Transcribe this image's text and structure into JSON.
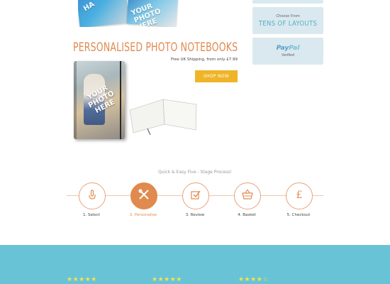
{
  "top_images": {
    "book_watermark_left": "HA",
    "book_watermark_right": "YOUR PHOTO HERE"
  },
  "info_boxes": {
    "choose_caption": "Choose From",
    "choose_main": "TENS OF LAYOUTS",
    "paypal_logo_1": "Pay",
    "paypal_logo_2": "Pal",
    "paypal_caption": "Verified"
  },
  "product": {
    "title": "PERSONALISED PHOTO NOTEBOOKS",
    "shipping": "Free UK Shipping, from only £7.99",
    "shop_button": "SHOP NOW",
    "notebook_watermark": "YOUR PHOTO HERE"
  },
  "process": {
    "title": "Quick & Easy Five - Stage Process!",
    "steps": [
      {
        "label": "1. Select",
        "icon": "hand-pointer-icon",
        "active": false
      },
      {
        "label": "2. Personalise",
        "icon": "tools-icon",
        "active": true
      },
      {
        "label": "3. Review",
        "icon": "checkbox-icon",
        "active": false
      },
      {
        "label": "4. Basket",
        "icon": "basket-icon",
        "active": false
      },
      {
        "label": "5. Checkout",
        "icon": "pound-icon",
        "active": false
      }
    ]
  },
  "reviews": {
    "ratings": [
      {
        "stars": "★★★★★"
      },
      {
        "stars": "★★★★★"
      },
      {
        "stars": "★★★★☆"
      }
    ]
  },
  "colors": {
    "accent_orange": "#e08a4f",
    "button_yellow": "#f0b429",
    "band_blue": "#69c3d6",
    "info_box_bg": "#d9e9ef"
  }
}
